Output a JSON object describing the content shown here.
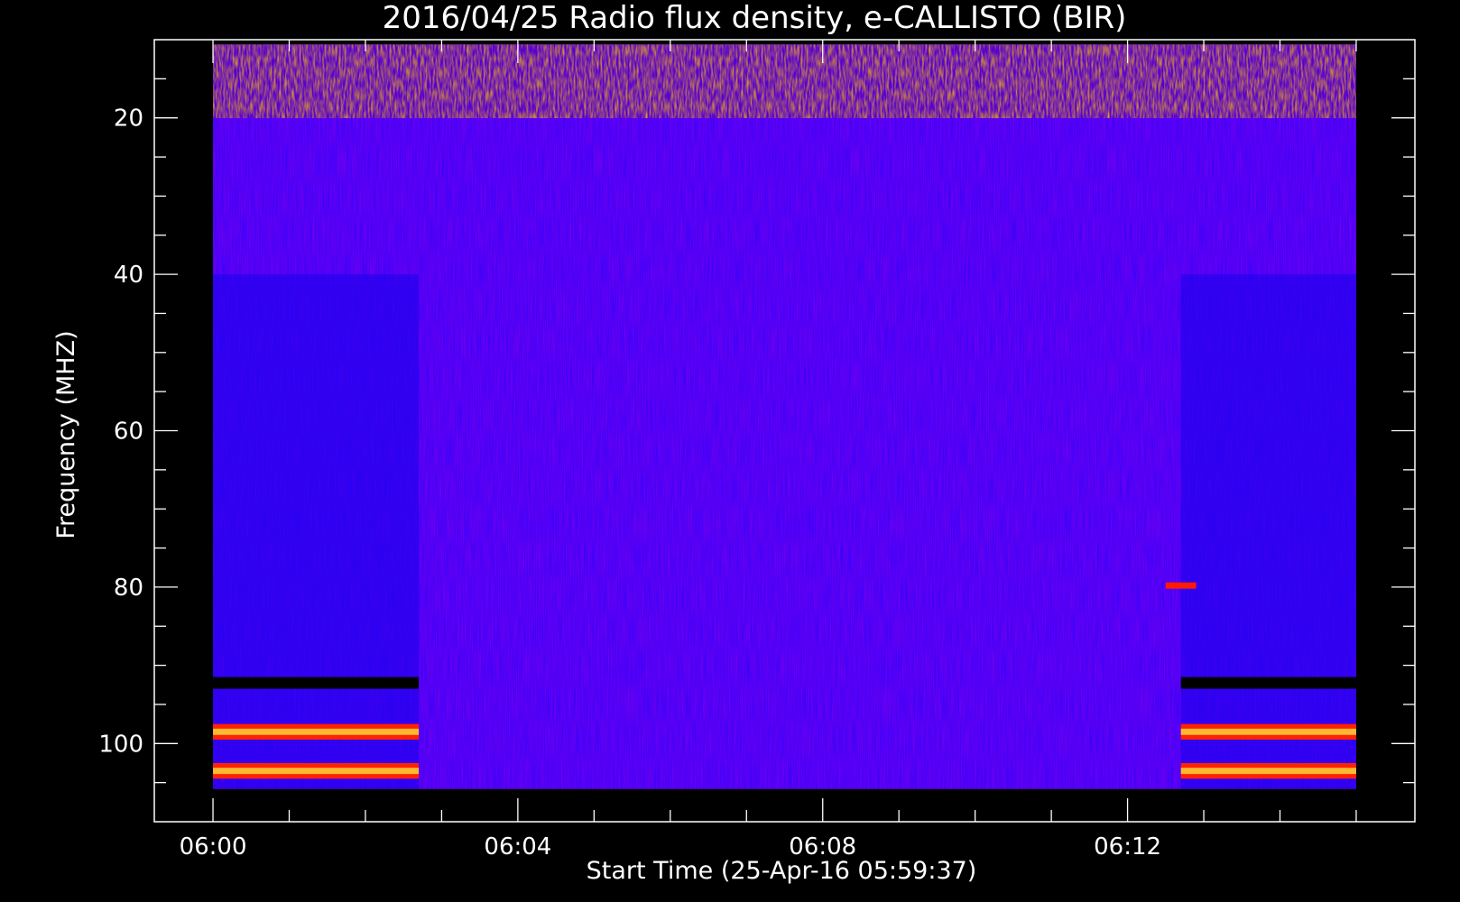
{
  "chart_data": {
    "type": "heatmap",
    "title": "2016/04/25  Radio flux density, e-CALLISTO (BIR)",
    "xlabel": "Start Time (25-Apr-16 05:59:37)",
    "ylabel": "Frequency (MHZ)",
    "x_ticks": [
      "06:00",
      "06:04",
      "06:08",
      "06:12"
    ],
    "x_tick_minutes": [
      0,
      4,
      8,
      12
    ],
    "xlim_minutes": [
      -0.77,
      15.77
    ],
    "x_data_range_minutes": [
      0,
      15
    ],
    "y_ticks": [
      20,
      40,
      60,
      80,
      100
    ],
    "ylim": [
      10,
      110
    ],
    "y_inverted": true,
    "y_data_range": [
      10,
      105.8
    ],
    "grid": false,
    "colormap": [
      "#000000",
      "#0000ff",
      "#ff0000",
      "#ffff00",
      "#ffffff"
    ],
    "background_color": "#000000",
    "features": [
      {
        "kind": "band",
        "freq_range": [
          10,
          20
        ],
        "t_range": [
          0,
          15
        ],
        "level": "high-variable"
      },
      {
        "kind": "band",
        "freq_range": [
          97.5,
          99.5
        ],
        "t_range": [
          0,
          2.7
        ],
        "level": "high"
      },
      {
        "kind": "band",
        "freq_range": [
          97.5,
          99.5
        ],
        "t_range": [
          12.7,
          15
        ],
        "level": "high"
      },
      {
        "kind": "band",
        "freq_range": [
          102.5,
          104.5
        ],
        "t_range": [
          0,
          2.7
        ],
        "level": "high"
      },
      {
        "kind": "band",
        "freq_range": [
          102.5,
          104.5
        ],
        "t_range": [
          12.7,
          15
        ],
        "level": "high"
      },
      {
        "kind": "band",
        "freq_range": [
          91.5,
          93
        ],
        "t_range": [
          0,
          2.7
        ],
        "level": "low"
      },
      {
        "kind": "band",
        "freq_range": [
          91.5,
          93
        ],
        "t_range": [
          12.7,
          15
        ],
        "level": "low"
      },
      {
        "kind": "spot",
        "freq": 79.8,
        "t_range": [
          12.5,
          12.9
        ],
        "level": "high"
      }
    ]
  }
}
